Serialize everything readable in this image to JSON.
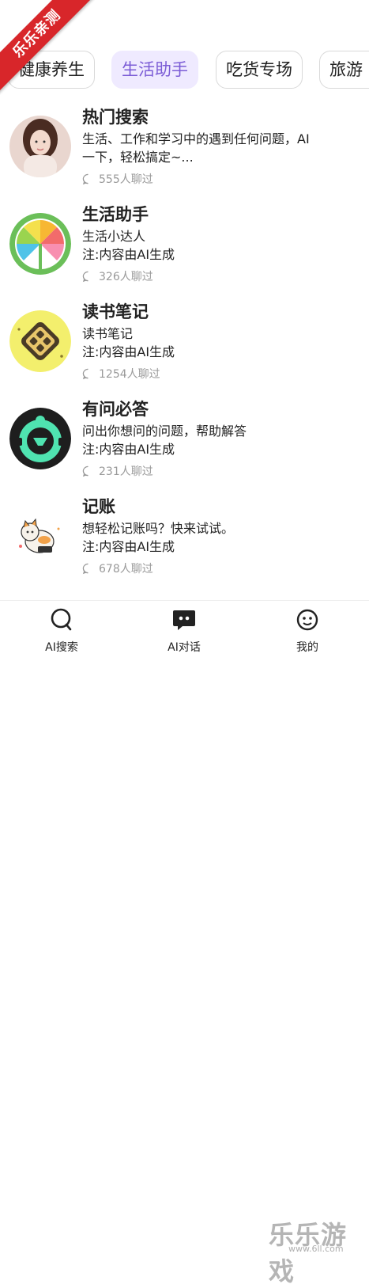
{
  "ribbon": {
    "label": "乐乐亲测"
  },
  "tabs": [
    {
      "label": "健康养生",
      "active": false
    },
    {
      "label": "生活助手",
      "active": true
    },
    {
      "label": "吃货专场",
      "active": false
    },
    {
      "label": "旅游",
      "active": false
    }
  ],
  "items": [
    {
      "title": "热门搜索",
      "desc": "生活、工作和学习中的遇到任何问题，AI一下，轻松搞定~...",
      "count": "555人聊过",
      "avatar": "portrait-avatar"
    },
    {
      "title": "生活助手",
      "desc": "生活小达人\n注:内容由AI生成",
      "count": "326人聊过",
      "avatar": "lemon-slice-avatar"
    },
    {
      "title": "读书笔记",
      "desc": "读书笔记\n注:内容由AI生成",
      "count": "1254人聊过",
      "avatar": "book-icon-avatar"
    },
    {
      "title": "有问必答",
      "desc": "问出你想问的问题，帮助解答\n注:内容由AI生成",
      "count": "231人聊过",
      "avatar": "robot-face-avatar"
    },
    {
      "title": "记账",
      "desc": "想轻松记账吗？快来试试。\n注:内容由AI生成",
      "count": "678人聊过",
      "avatar": "cat-illustration-avatar"
    }
  ],
  "nav": [
    {
      "label": "AI搜索",
      "icon": "search-icon"
    },
    {
      "label": "AI对话",
      "icon": "chat-icon"
    },
    {
      "label": "我的",
      "icon": "profile-icon"
    }
  ],
  "watermark": {
    "text": "乐乐游戏",
    "url": "www.6ll.com"
  }
}
